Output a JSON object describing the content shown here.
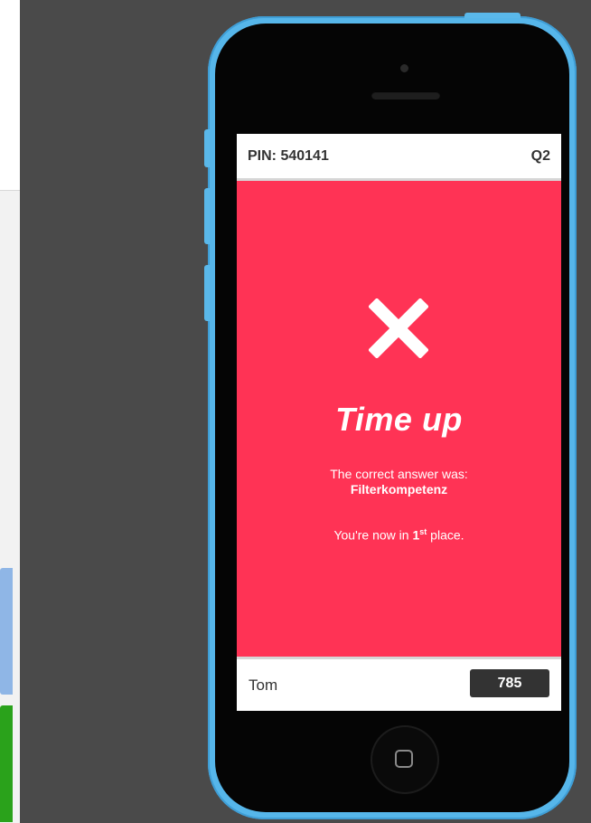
{
  "header": {
    "pin": "PIN: 540141",
    "question": "Q2"
  },
  "result": {
    "icon": "cross-icon",
    "title": "Time up",
    "correct_label": "The correct answer was:",
    "correct_answer": "Filterkompetenz",
    "place_prefix": "You're now in ",
    "place_number": "1",
    "place_suffix": "st",
    "place_end": " place."
  },
  "footer": {
    "player_name": "Tom",
    "score": "785"
  },
  "colors": {
    "result_bg": "#ff3355",
    "phone_body": "#56b6ea",
    "score_bg": "#333333",
    "backdrop": "#4a4a4a"
  }
}
